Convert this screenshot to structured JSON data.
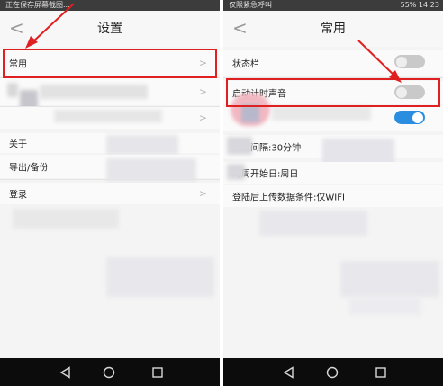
{
  "left": {
    "status_text": "正在保存屏幕截图...",
    "title": "设置",
    "back_symbol": "<",
    "rows": [
      {
        "label": "常用"
      },
      {
        "label": "关于"
      },
      {
        "label": "导出/备份"
      },
      {
        "label": "登录"
      }
    ]
  },
  "right": {
    "status_left": "仅限紧急呼叫",
    "status_right": "55% 14:23",
    "title": "常用",
    "back_symbol": "<",
    "rows": [
      {
        "label": "状态栏"
      },
      {
        "label": "启动计时声音"
      },
      {
        "label": "提醒间隔:30分钟"
      },
      {
        "label": "每周开始日:周日"
      },
      {
        "label": "登陆后上传数据条件:仅WIFI"
      }
    ],
    "toggles": [
      {
        "state": "off"
      },
      {
        "state": "off"
      },
      {
        "state": "on"
      }
    ]
  },
  "colors": {
    "highlight": "#e02020",
    "toggle_on": "#2a8de0",
    "toggle_off": "#c9c9c9"
  }
}
